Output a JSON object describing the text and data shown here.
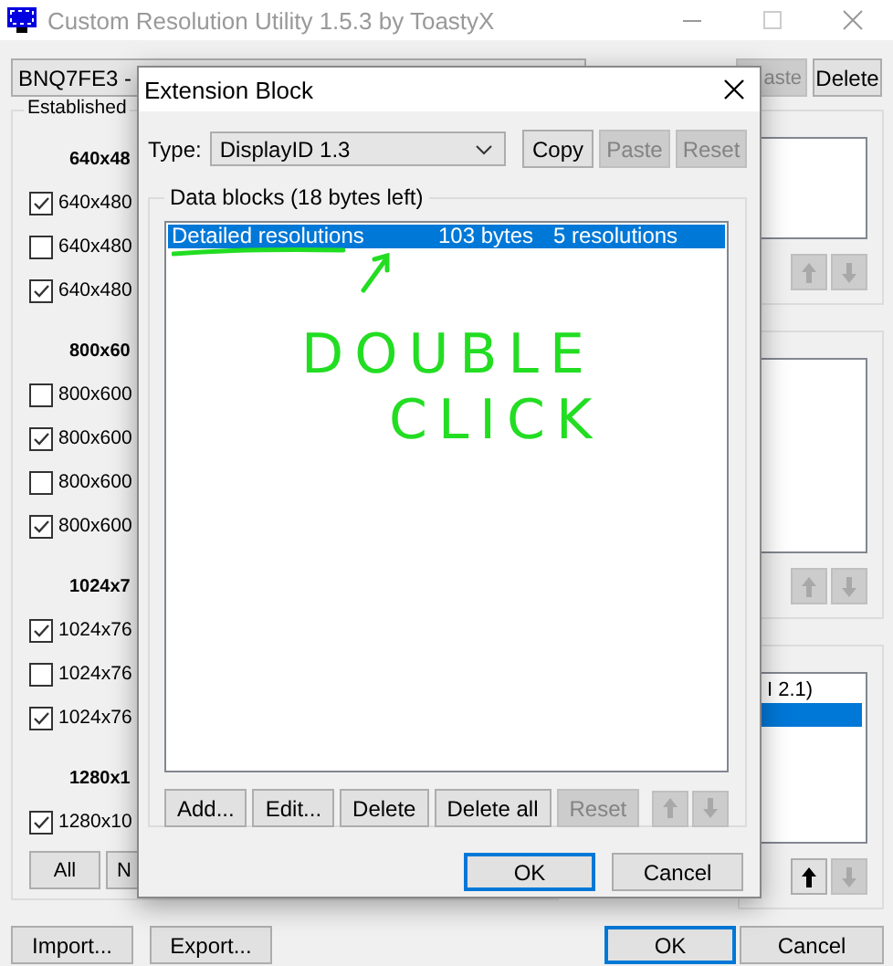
{
  "window": {
    "title": "Custom Resolution Utility 1.5.3 by ToastyX"
  },
  "monitor_select": {
    "value": "BNQ7FE3 -"
  },
  "top_buttons": [
    {
      "label": "aste",
      "disabled": true
    },
    {
      "label": "Delete",
      "disabled": false
    }
  ],
  "established": {
    "title": "Established",
    "sections": [
      {
        "heading": "640x48",
        "items": [
          {
            "label": "640x480",
            "checked": true
          },
          {
            "label": "640x480",
            "checked": false
          },
          {
            "label": "640x480",
            "checked": true
          }
        ]
      },
      {
        "heading": "800x60",
        "items": [
          {
            "label": "800x600",
            "checked": false
          },
          {
            "label": "800x600",
            "checked": true
          },
          {
            "label": "800x600",
            "checked": false
          },
          {
            "label": "800x600",
            "checked": true
          }
        ]
      },
      {
        "heading": "1024x7",
        "items": [
          {
            "label": "1024x76",
            "checked": true
          },
          {
            "label": "1024x76",
            "checked": false
          },
          {
            "label": "1024x76",
            "checked": true
          }
        ]
      },
      {
        "heading": "1280x1",
        "items": [
          {
            "label": "1280x10",
            "checked": true
          }
        ]
      }
    ],
    "buttons": [
      "All",
      "N"
    ]
  },
  "right_groups": [
    {
      "arrows": [
        {
          "kind": "up",
          "disabled": true
        },
        {
          "kind": "down",
          "disabled": true
        }
      ]
    },
    {
      "arrows": [
        {
          "kind": "up",
          "disabled": true
        },
        {
          "kind": "down",
          "disabled": true
        }
      ]
    },
    {
      "rows": [
        {
          "label": "I 2.1)",
          "selected": false
        },
        {
          "selected": true
        }
      ],
      "arrows": [
        {
          "kind": "up",
          "disabled": false
        },
        {
          "kind": "down",
          "disabled": true
        }
      ]
    }
  ],
  "bottom_left_buttons": [
    "Import...",
    "Export..."
  ],
  "bottom_right_buttons": [
    {
      "label": "OK",
      "focused": true
    },
    {
      "label": "Cancel",
      "focused": false
    }
  ],
  "dialog": {
    "title": "Extension Block",
    "type_label": "Type:",
    "type_value": "DisplayID 1.3",
    "type_buttons": [
      {
        "label": "Copy",
        "disabled": false
      },
      {
        "label": "Paste",
        "disabled": true
      },
      {
        "label": "Reset",
        "disabled": true
      }
    ],
    "group_title": "Data blocks (18 bytes left)",
    "blocks": [
      {
        "name": "Detailed resolutions",
        "size": "103 bytes",
        "info": "5 resolutions",
        "selected": true
      }
    ],
    "list_buttons": [
      {
        "label": "Add...",
        "disabled": false
      },
      {
        "label": "Edit...",
        "disabled": false
      },
      {
        "label": "Delete",
        "disabled": false
      },
      {
        "label": "Delete all",
        "disabled": false
      },
      {
        "label": "Reset",
        "disabled": true
      }
    ],
    "arrows": [
      {
        "kind": "up",
        "disabled": true
      },
      {
        "kind": "down",
        "disabled": true
      }
    ],
    "footer_buttons": [
      {
        "label": "OK",
        "focused": true
      },
      {
        "label": "Cancel",
        "focused": false
      }
    ]
  },
  "annotation": {
    "lines": [
      "DOUBLE",
      "CLICK"
    ]
  }
}
